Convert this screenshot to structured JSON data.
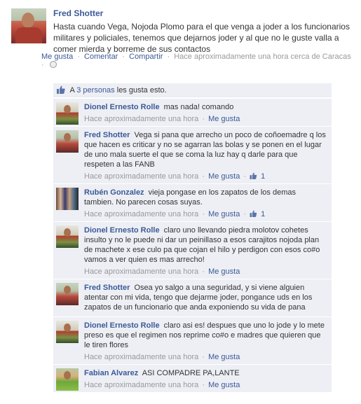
{
  "post": {
    "author": "Fred Shotter",
    "text": "Hasta cuando Vega, Nojoda Plomo para el que venga a joder a los funcionarios militares y policiales, tenemos que dejarnos joder y al que no le guste valla a comer mierda y borreme de sus contactos",
    "actions": {
      "like": "Me gusta",
      "comment": "Comentar",
      "share": "Compartir",
      "timestamp": "Hace aproximadamente una hora cerca de Caracas"
    }
  },
  "likes_summary": {
    "prefix": "A",
    "link": "3 personas",
    "suffix": "les gusta esto."
  },
  "comments": [
    {
      "author": "Dionel Ernesto Rolle",
      "text": "mas nada! comando",
      "time": "Hace aproximadamente una hora",
      "like_label": "Me gusta",
      "like_count": ""
    },
    {
      "author": "Fred Shotter",
      "text": "Vega si pana que arrecho un poco de coñoemadre q los que hacen es criticar y no se agarran las bolas y se ponen en el lugar de uno mala suerte el que se coma la luz hay q darle para que respeten a las FANB",
      "time": "Hace aproximadamente una hora",
      "like_label": "Me gusta",
      "like_count": "1"
    },
    {
      "author": "Rubén Gonzalez",
      "text": "vieja pongase en los zapatos de los demas tambien. No parecen cosas suyas.",
      "time": "Hace aproximadamente una hora",
      "like_label": "Me gusta",
      "like_count": "1"
    },
    {
      "author": "Dionel Ernesto Rolle",
      "text": "claro uno llevando piedra molotov cohetes insulto y no le puede ni dar un peinillaso a esos carajitos nojoda plan de machete x ese culo pa que cojan el hilo y perdigon con esos co#o vamos a ver quien es mas arrecho!",
      "time": "Hace aproximadamente una hora",
      "like_label": "Me gusta",
      "like_count": ""
    },
    {
      "author": "Fred Shotter",
      "text": "Osea yo salgo a una seguridad, y si viene alguien atentar con mi vida, tengo que dejarme joder, pongance uds en los zapatos de un funcionario que anda exponiendo su vida de pana",
      "time": "",
      "like_label": "",
      "like_count": ""
    },
    {
      "author": "Dionel Ernesto Rolle",
      "text": "claro asi es! despues que uno lo jode y lo mete preso es que el regimen nos reprime co#o e madres que quieren que le tiren flores",
      "time": "Hace aproximadamente una hora",
      "like_label": "Me gusta",
      "like_count": ""
    },
    {
      "author": "Fabian Alvarez",
      "text": "ASI COMPADRE PA,LANTE",
      "time": "Hace aproximadamente una hora",
      "like_label": "Me gusta",
      "like_count": ""
    }
  ]
}
